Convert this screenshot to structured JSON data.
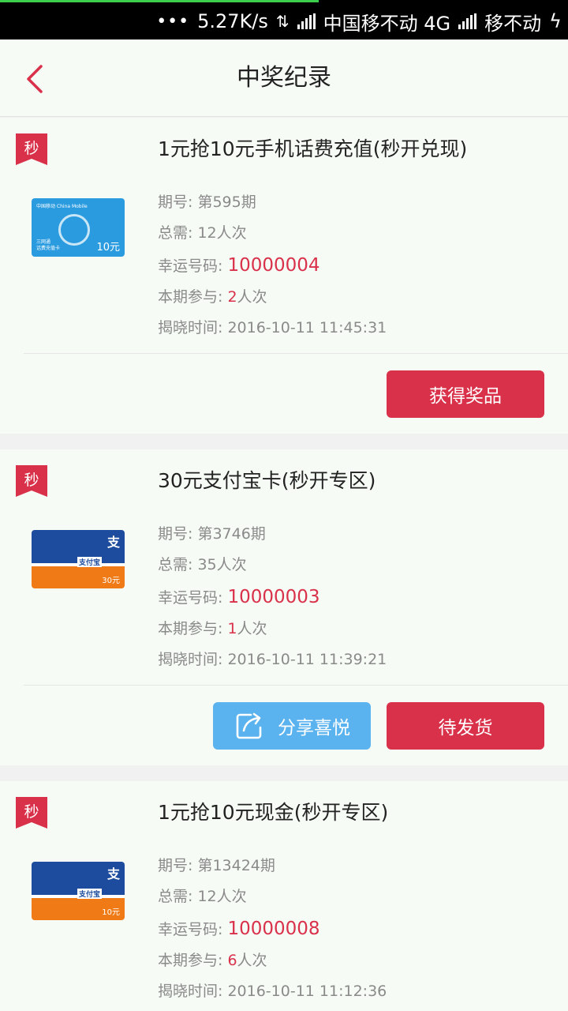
{
  "status_bar": {
    "dots": "•••",
    "speed": "5.27K/s",
    "carrier1": "中国移不动 4G",
    "carrier2": "移不动"
  },
  "header": {
    "title": "中奖纪录"
  },
  "labels": {
    "issue": "期号: ",
    "need": "总需: ",
    "lucky": "幸运号码: ",
    "joined": "本期参与: ",
    "reveal": "揭晓时间: ",
    "times_unit": "人次"
  },
  "records": [
    {
      "badge": "秒",
      "title": "1元抢10元手机话费充值(秒开兑现)",
      "card_type": "mobile",
      "card_header": "中国移动 China Mobile",
      "card_sub1": "三网通",
      "card_sub2": "话费充值卡",
      "card_amount": "10元",
      "issue": "第595期",
      "need": "12人次",
      "lucky": "10000004",
      "joined_count": "2",
      "reveal_time": "2016-10-11 11:45:31",
      "primary_button": "获得奖品",
      "share_button": ""
    },
    {
      "badge": "秒",
      "title": "30元支付宝卡(秒开专区)",
      "card_type": "alipay",
      "card_zhi": "支",
      "card_brand": "支付宝",
      "card_amount": "30元",
      "issue": "第3746期",
      "need": "35人次",
      "lucky": "10000003",
      "joined_count": "1",
      "reveal_time": "2016-10-11 11:39:21",
      "primary_button": "待发货",
      "share_button": "分享喜悦"
    },
    {
      "badge": "秒",
      "title": "1元抢10元现金(秒开专区)",
      "card_type": "alipay",
      "card_zhi": "支",
      "card_brand": "支付宝",
      "card_amount": "10元",
      "issue": "第13424期",
      "need": "12人次",
      "lucky": "10000008",
      "joined_count": "6",
      "reveal_time": "2016-10-11 11:12:36",
      "primary_button": "",
      "share_button": ""
    }
  ],
  "colors": {
    "accent": "#d9314a",
    "share": "#5ab2ee",
    "card_bg": "#f7fbf6",
    "page_bg": "#f1f1f1"
  }
}
